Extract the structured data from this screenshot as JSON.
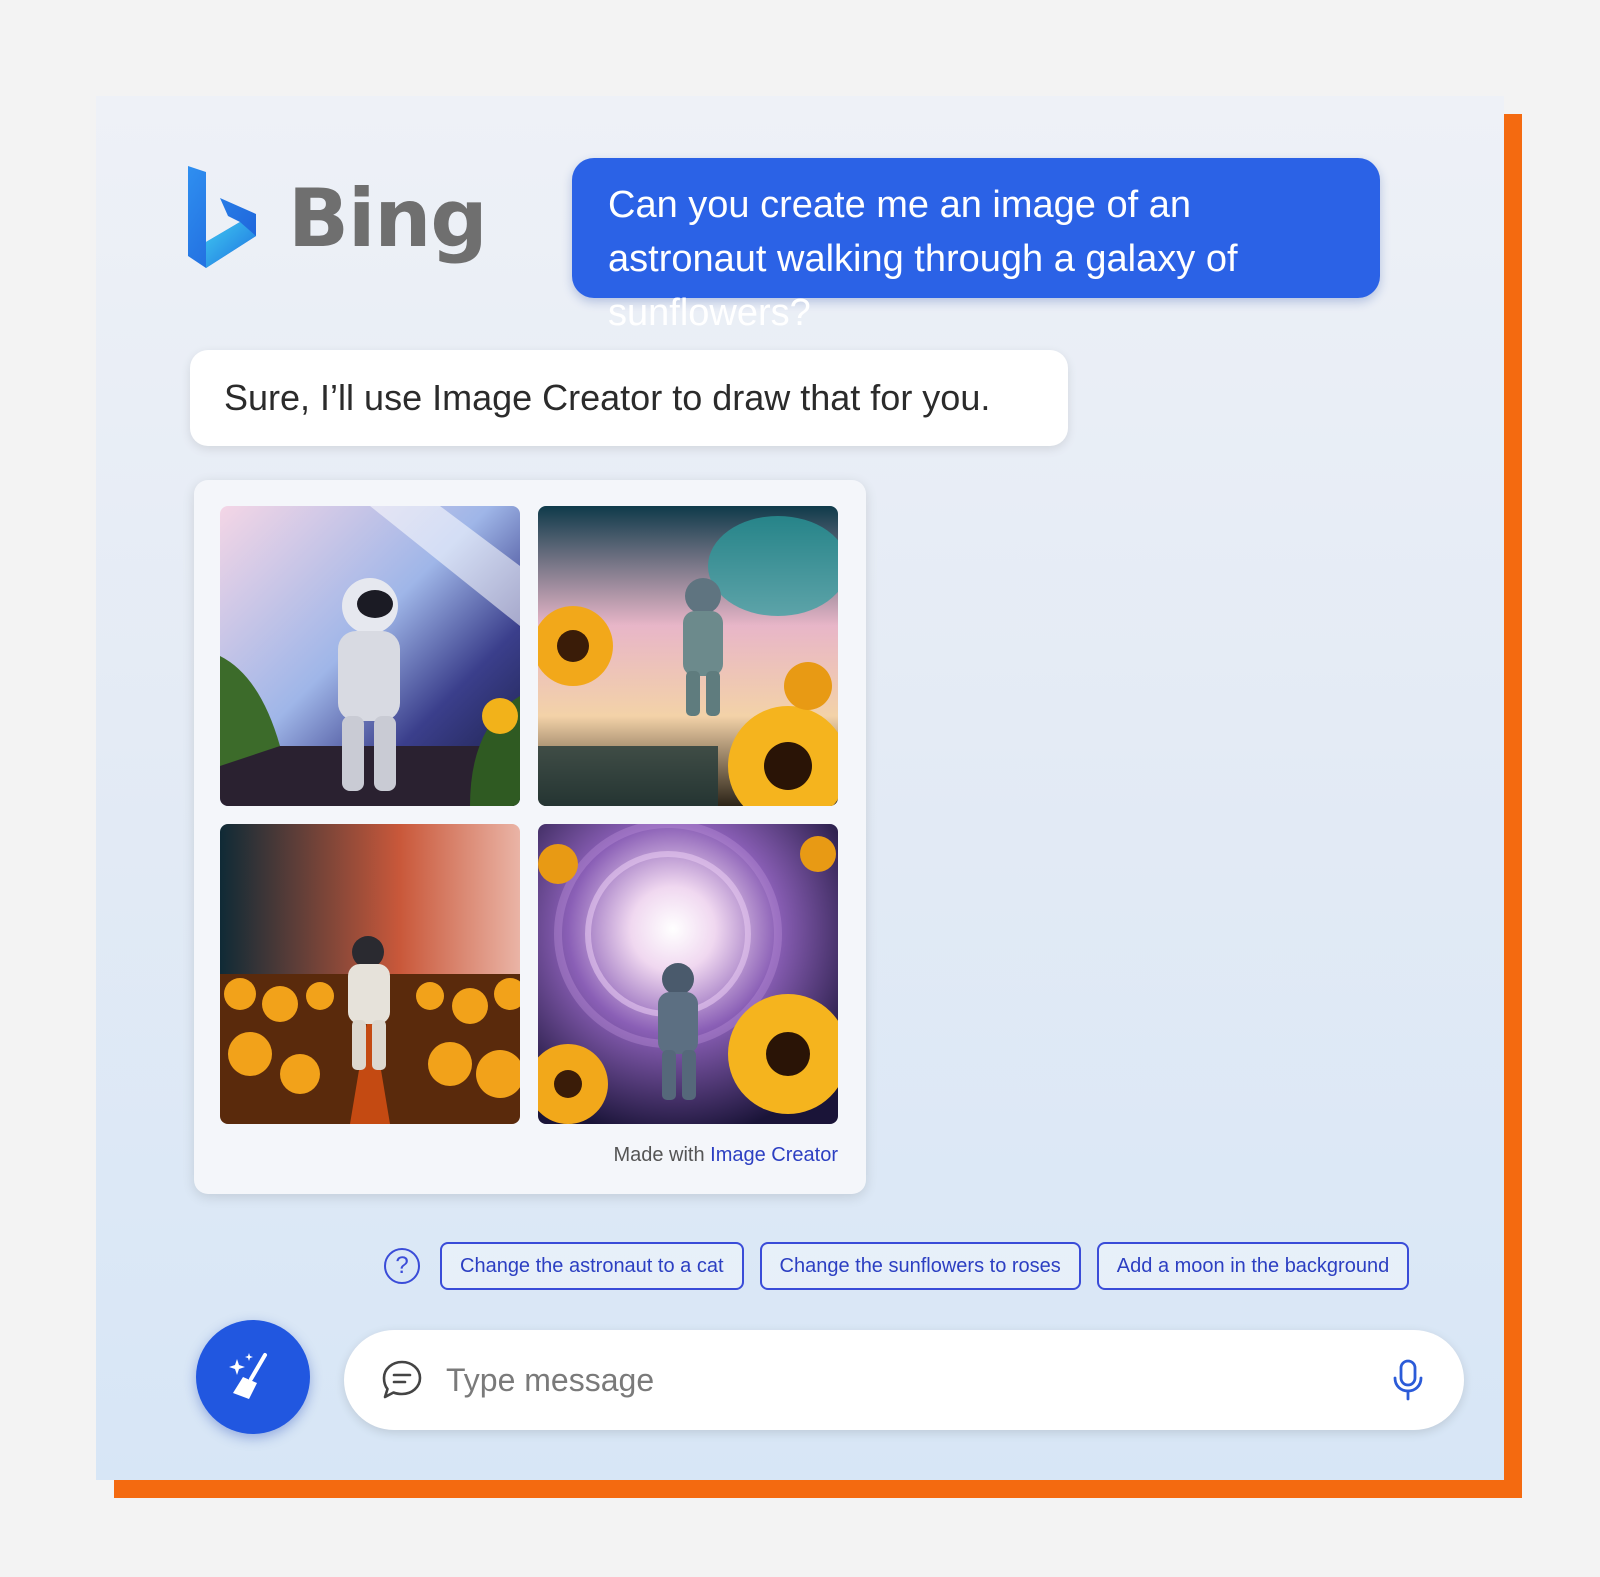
{
  "app": {
    "name": "Bing"
  },
  "colors": {
    "accent": "#2b62e6",
    "chip_border": "#3a4cd8",
    "frame_shadow": "#f46a10"
  },
  "conversation": {
    "user_message": "Can you create me an image of an astronaut walking through a galaxy of sunflowers?",
    "bot_message": "Sure, I’ll use Image Creator to draw that for you.",
    "image_card": {
      "images": [
        {
          "icon": "astronaut-sunflower-image-1"
        },
        {
          "icon": "astronaut-sunflower-image-2"
        },
        {
          "icon": "astronaut-sunflower-image-3"
        },
        {
          "icon": "astronaut-sunflower-image-4"
        }
      ],
      "credit_prefix": "Made with",
      "credit_link": "Image Creator"
    }
  },
  "suggestions": {
    "help_icon": "question-icon",
    "chips": [
      "Change the astronaut to a cat",
      "Change the sunflowers to roses",
      "Add a moon in the background"
    ]
  },
  "composer": {
    "new_topic_icon": "broom-sparkle-icon",
    "chat_icon": "chat-bubble-icon",
    "placeholder": "Type message",
    "mic_icon": "microphone-icon"
  }
}
